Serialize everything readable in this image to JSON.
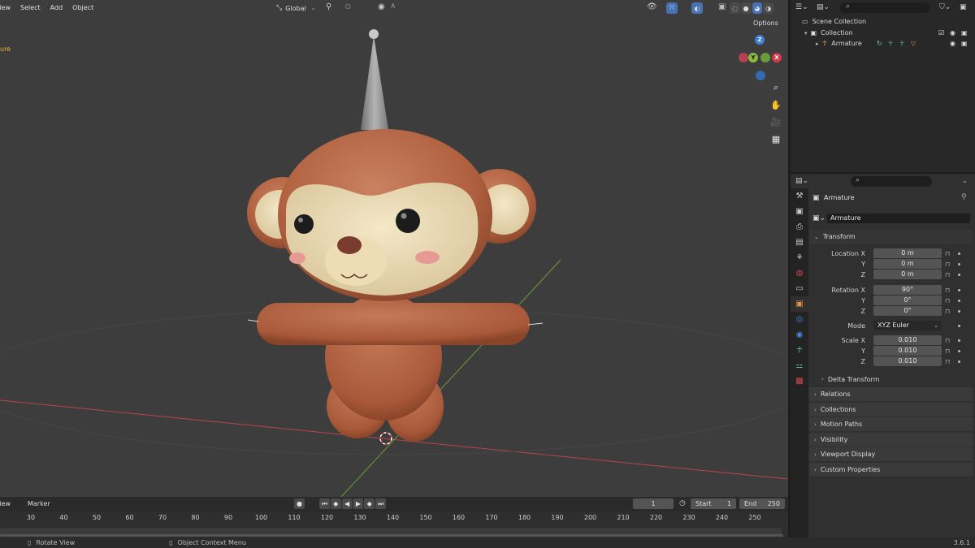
{
  "viewport": {
    "menu": [
      "View",
      "Select",
      "Add",
      "Object"
    ],
    "transform_orientation": "Global",
    "options_label": "Options",
    "overlay_text": "ure",
    "gizmo": {
      "z": "Z",
      "y": "Y",
      "x": "X"
    }
  },
  "outliner": {
    "search_placeholder": "",
    "scene_collection": "Scene Collection",
    "collection": "Collection",
    "armature": "Armature"
  },
  "properties": {
    "object_name": "Armature",
    "data_name": "Armature",
    "transform_label": "Transform",
    "location_label": "Location X",
    "rotation_label": "Rotation X",
    "mode_label": "Mode",
    "scale_label": "Scale X",
    "axis_y": "Y",
    "axis_z": "Z",
    "location": [
      "0 m",
      "0 m",
      "0 m"
    ],
    "rotation": [
      "90°",
      "0°",
      "0°"
    ],
    "mode_value": "XYZ Euler",
    "scale": [
      "0.010",
      "0.010",
      "0.010"
    ],
    "delta_transform": "Delta Transform",
    "panels": [
      "Relations",
      "Collections",
      "Motion Paths",
      "Visibility",
      "Viewport Display",
      "Custom Properties"
    ]
  },
  "timeline": {
    "menu": [
      "View",
      "Marker"
    ],
    "current_frame": "1",
    "start_label": "Start",
    "start_value": "1",
    "end_label": "End",
    "end_value": "250",
    "ticks": [
      "30",
      "40",
      "50",
      "60",
      "70",
      "80",
      "90",
      "100",
      "110",
      "120",
      "130",
      "140",
      "150",
      "160",
      "170",
      "180",
      "190",
      "200",
      "210",
      "220",
      "230",
      "240",
      "250"
    ]
  },
  "status": {
    "rotate_view": "Rotate View",
    "context_menu": "Object Context Menu",
    "version": "3.6.1"
  },
  "colors": {
    "viewport_bg": "#3d3d3d",
    "accent_blue": "#4772b3",
    "axis_red": "#c0444c",
    "axis_green": "#77a83b",
    "monkey_fur": "#b86a48",
    "monkey_face": "#ecdcb8"
  }
}
